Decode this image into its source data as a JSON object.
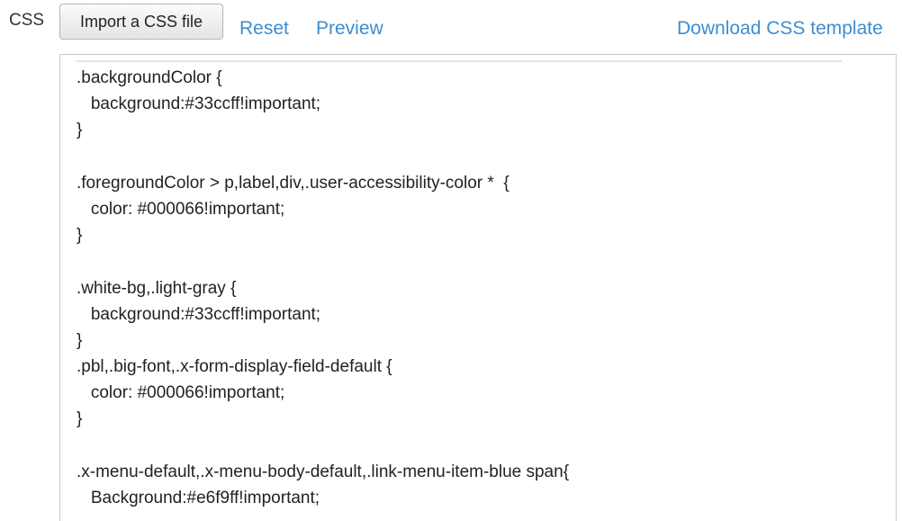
{
  "toolbar": {
    "css_label": "CSS",
    "import_button_label": "Import a CSS file",
    "reset_label": "Reset",
    "preview_label": "Preview",
    "download_label": "Download CSS template"
  },
  "editor": {
    "lines": [
      ".backgroundColor {",
      "   background:#33ccff!important;",
      "}",
      "",
      ".foregroundColor > p,label,div,.user-accessibility-color *  {",
      "   color: #000066!important;",
      "}",
      "",
      ".white-bg,.light-gray {",
      "   background:#33ccff!important;",
      "}",
      ".pbl,.big-font,.x-form-display-field-default {",
      "   color: #000066!important;",
      "}",
      "",
      ".x-menu-default,.x-menu-body-default,.link-menu-item-blue span{",
      "   Background:#e6f9ff!important;"
    ]
  },
  "colors": {
    "link": "#3e8ed0",
    "text": "#222222",
    "border": "#c8c8c8"
  }
}
